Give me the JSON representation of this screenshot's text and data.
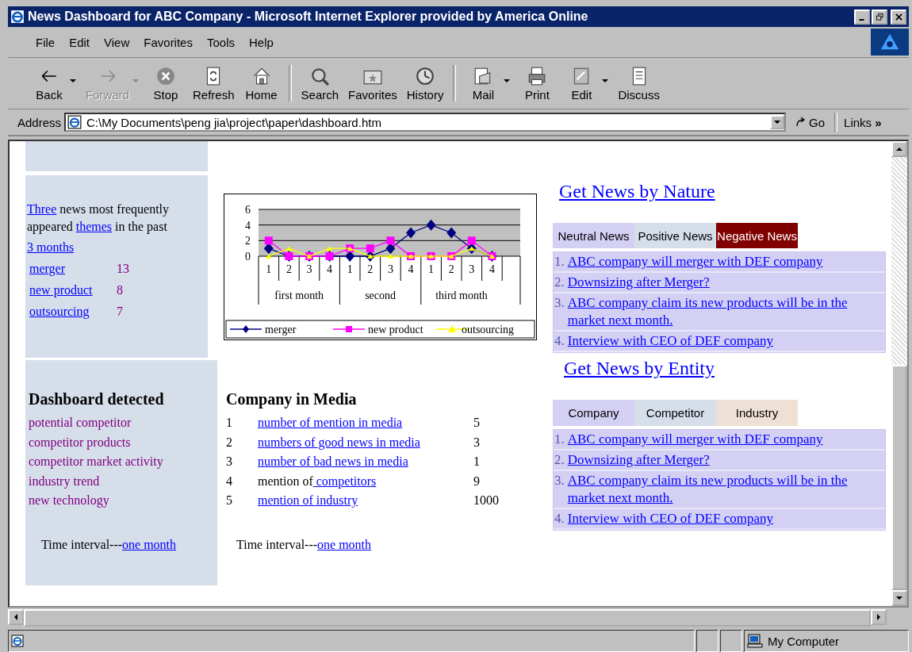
{
  "window": {
    "title": "News Dashboard for ABC Company - Microsoft Internet Explorer provided by America Online"
  },
  "menu": [
    "File",
    "Edit",
    "View",
    "Favorites",
    "Tools",
    "Help"
  ],
  "toolbar": [
    {
      "kind": "back",
      "label": "Back",
      "disabled": false,
      "dropdown": true
    },
    {
      "kind": "forward",
      "label": "Forward",
      "disabled": true,
      "dropdown": true
    },
    {
      "kind": "stop",
      "label": "Stop",
      "disabled": false,
      "dropdown": false
    },
    {
      "kind": "refresh",
      "label": "Refresh",
      "disabled": false,
      "dropdown": false
    },
    {
      "kind": "home",
      "label": "Home",
      "disabled": false,
      "dropdown": false
    },
    {
      "kind": "search",
      "label": "Search",
      "disabled": false,
      "dropdown": false
    },
    {
      "kind": "favorites",
      "label": "Favorites",
      "disabled": false,
      "dropdown": false
    },
    {
      "kind": "history",
      "label": "History",
      "disabled": false,
      "dropdown": false
    },
    {
      "kind": "mail",
      "label": "Mail",
      "disabled": false,
      "dropdown": true
    },
    {
      "kind": "print",
      "label": "Print",
      "disabled": false,
      "dropdown": false
    },
    {
      "kind": "edit",
      "label": "Edit",
      "disabled": false,
      "dropdown": true
    },
    {
      "kind": "discuss",
      "label": "Discuss",
      "disabled": false,
      "dropdown": false
    }
  ],
  "address": {
    "label": "Address",
    "value": "C:\\My Documents\\peng jia\\project\\paper\\dashboard.htm",
    "go": "Go",
    "links": "Links",
    "more": "»"
  },
  "themes": {
    "intro": [
      {
        "text": "Three",
        "link": true
      },
      {
        "text": " news most frequently appeared ",
        "link": false
      },
      {
        "text": "themes",
        "link": true
      },
      {
        "text": " in the past ",
        "link": false
      }
    ],
    "period": "3 months",
    "items": [
      {
        "label": "merger",
        "count": "13"
      },
      {
        "label": "new product",
        "count": "8"
      },
      {
        "label": "outsourcing",
        "count": "7"
      }
    ]
  },
  "chart": {
    "chart_data": {
      "type": "line",
      "categories": [
        "1",
        "2",
        "3",
        "4",
        "1",
        "2",
        "3",
        "4",
        "1",
        "2",
        "3",
        "4"
      ],
      "annotations": [
        {
          "text": "first month"
        },
        {
          "text": "second"
        },
        {
          "text": "third month"
        }
      ],
      "ylim": [
        0,
        6
      ],
      "yticks": [
        0,
        2,
        4,
        6
      ],
      "legend": "bottom",
      "series": [
        {
          "name": "merger",
          "color": "#000080",
          "marker": "diamond",
          "values": [
            1,
            0,
            0,
            0,
            0,
            0,
            1,
            3,
            4,
            3,
            1,
            0
          ]
        },
        {
          "name": "new product",
          "color": "#ff00ff",
          "marker": "square",
          "values": [
            2,
            0,
            0,
            0,
            1,
            1,
            2,
            0,
            0,
            0,
            2,
            0
          ]
        },
        {
          "name": "outsourcing",
          "color": "#ffff00",
          "marker": "triangle",
          "values": [
            0,
            1,
            0,
            1,
            1,
            0,
            0,
            0,
            0,
            0,
            1,
            0
          ]
        }
      ]
    }
  },
  "dashboard": {
    "title": "Dashboard detected",
    "items": [
      "potential competitor",
      "competitor products",
      "competitor market activity",
      "industry trend",
      "new technology"
    ],
    "interval": {
      "text": "Time interval---",
      "link": "one month"
    }
  },
  "media": {
    "title": "Company in Media",
    "rows": [
      {
        "rank": "1",
        "link": "number of mention in media",
        "value": "5"
      },
      {
        "rank": "2",
        "link": "numbers of good news in media",
        "value": "3"
      },
      {
        "rank": "3",
        "link": "number of bad news in media",
        "value": "1"
      },
      {
        "rank": "4",
        "text": "mention of",
        "link": " competitors",
        "value": "9"
      },
      {
        "rank": "5",
        "link": "mention of industry",
        "value": "1000"
      }
    ],
    "interval": {
      "text": "Time interval---",
      "link": "one month"
    }
  },
  "by_nature": {
    "title": "Get News by Nature",
    "tabs": [
      {
        "label": "Neutral News",
        "color": "#d4d0f4",
        "selected": false
      },
      {
        "label": "Positive News",
        "color": "#d6deea",
        "selected": false
      },
      {
        "label": "Negative News",
        "color": "#800000",
        "selected": true
      }
    ],
    "news": [
      {
        "number": "1.",
        "title": "ABC company will merger with DEF company"
      },
      {
        "number": "2.",
        "title": "Downsizing after Merger?"
      },
      {
        "number": "3.",
        "title": "ABC company claim its new products will be in the market next month."
      },
      {
        "number": "4.",
        "title": "Interview with CEO of DEF company"
      }
    ]
  },
  "by_entity": {
    "title": "Get News by Entity",
    "tabs": [
      {
        "label": "Company",
        "color": "#d4d0f4"
      },
      {
        "label": "Competitor",
        "color": "#d6deea"
      },
      {
        "label": "Industry",
        "color": "#eee0d4"
      }
    ],
    "news": [
      {
        "number": "1.",
        "title": "ABC company will merger with DEF company"
      },
      {
        "number": "2.",
        "title": "Downsizing after Merger?"
      },
      {
        "number": "3.",
        "title": "ABC company claim its new products will be in the market next month."
      },
      {
        "number": "4.",
        "title": "Interview with CEO of DEF company"
      }
    ]
  },
  "status_bar": {
    "zone": "My Computer"
  }
}
